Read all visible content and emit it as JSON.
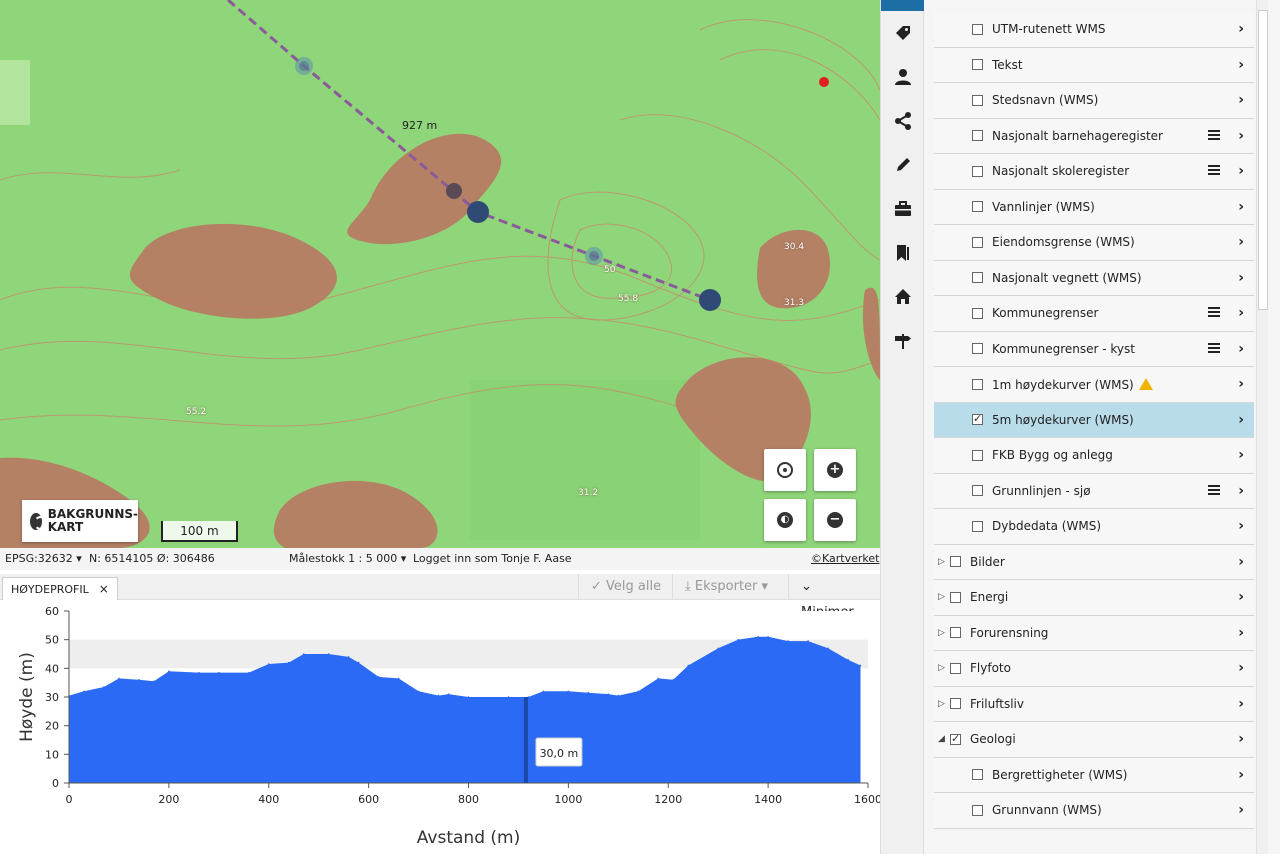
{
  "map": {
    "distance_label": "927 m",
    "contour_labels": [
      "30.4",
      "31.3",
      "55.8",
      "50",
      "55.2",
      "31.2"
    ],
    "basemap_button": {
      "line1": "BAKGRUNNS-",
      "line2": "KART"
    },
    "scale_label": "100 m"
  },
  "statusbar": {
    "projection": "EPSG:32632 ▾",
    "coordinates": "N: 6514105 Ø: 306486",
    "scale": "Målestokk 1 : 5 000 ▾",
    "user": "Logget inn som Tonje F. Aase",
    "attribution": "©Kartverket"
  },
  "profile": {
    "tab_label": "HØYDEPROFIL",
    "tab_close": "×",
    "select_all": "✓ Velg alle",
    "export": "⤓ Eksporter ▾",
    "minimize": "⌄ Minimer"
  },
  "chart_data": {
    "type": "area",
    "xlabel": "Avstand (m)",
    "ylabel": "Høyde (m)",
    "xlim": [
      0,
      1600
    ],
    "ylim": [
      0,
      60
    ],
    "xticks": [
      0,
      200,
      400,
      600,
      800,
      1000,
      1200,
      1400,
      1600
    ],
    "yticks": [
      0,
      10,
      20,
      30,
      40,
      50,
      60
    ],
    "x": [
      0,
      30,
      70,
      100,
      140,
      170,
      200,
      260,
      300,
      360,
      400,
      440,
      470,
      520,
      560,
      580,
      620,
      660,
      700,
      740,
      760,
      800,
      880,
      920,
      950,
      1000,
      1040,
      1080,
      1100,
      1140,
      1180,
      1210,
      1240,
      1300,
      1340,
      1380,
      1400,
      1440,
      1480,
      1520,
      1560,
      1585
    ],
    "values": [
      30.5,
      32,
      33.5,
      36.5,
      36,
      35.5,
      39,
      38.5,
      38.5,
      38.5,
      41.5,
      42,
      45,
      45,
      44,
      42,
      37,
      36.5,
      32,
      30.5,
      31,
      30,
      30,
      30,
      32,
      32,
      31.5,
      31,
      30.5,
      32,
      36.5,
      36,
      41,
      47,
      50,
      51,
      51,
      49.5,
      49.5,
      47,
      43,
      41
    ],
    "band": [
      40,
      50
    ],
    "cursor": {
      "x": 915,
      "label": "30,0 m"
    },
    "colors": {
      "fill": "#2b6af5",
      "band": "#eeeeee",
      "cursor": "#1a49a8"
    }
  },
  "layers": [
    {
      "label": "UTM-rutenett WMS",
      "checked": false,
      "menu": false,
      "level": 2
    },
    {
      "label": "Tekst",
      "checked": false,
      "menu": false,
      "level": 2
    },
    {
      "label": "Stedsnavn (WMS)",
      "checked": false,
      "menu": false,
      "level": 2
    },
    {
      "label": "Nasjonalt barnehageregister",
      "checked": false,
      "menu": true,
      "level": 2
    },
    {
      "label": "Nasjonalt skoleregister",
      "checked": false,
      "menu": true,
      "level": 2
    },
    {
      "label": "Vannlinjer (WMS)",
      "checked": false,
      "menu": false,
      "level": 2
    },
    {
      "label": "Eiendomsgrense (WMS)",
      "checked": false,
      "menu": false,
      "level": 2
    },
    {
      "label": "Nasjonalt vegnett (WMS)",
      "checked": false,
      "menu": false,
      "level": 2
    },
    {
      "label": "Kommunegrenser",
      "checked": false,
      "menu": true,
      "level": 2
    },
    {
      "label": "Kommunegrenser - kyst",
      "checked": false,
      "menu": true,
      "level": 2
    },
    {
      "label": "1m høydekurver (WMS)",
      "checked": false,
      "menu": false,
      "level": 2,
      "warning": true
    },
    {
      "label": "5m høydekurver (WMS)",
      "checked": true,
      "menu": false,
      "level": 2,
      "selected": true
    },
    {
      "label": "FKB Bygg og anlegg",
      "checked": false,
      "menu": false,
      "level": 2
    },
    {
      "label": "Grunnlinjen - sjø",
      "checked": false,
      "menu": true,
      "level": 2
    },
    {
      "label": "Dybdedata (WMS)",
      "checked": false,
      "menu": false,
      "level": 2
    },
    {
      "label": "Bilder",
      "checked": false,
      "menu": false,
      "level": 1,
      "expander": "▷"
    },
    {
      "label": "Energi",
      "checked": false,
      "menu": false,
      "level": 1,
      "expander": "▷"
    },
    {
      "label": "Forurensning",
      "checked": false,
      "menu": false,
      "level": 1,
      "expander": "▷"
    },
    {
      "label": "Flyfoto",
      "checked": false,
      "menu": false,
      "level": 1,
      "expander": "▷"
    },
    {
      "label": "Friluftsliv",
      "checked": false,
      "menu": false,
      "level": 1,
      "expander": "▷"
    },
    {
      "label": "Geologi",
      "checked": true,
      "menu": false,
      "level": 1,
      "expander": "◢"
    },
    {
      "label": "Bergrettigheter (WMS)",
      "checked": false,
      "menu": false,
      "level": 2
    },
    {
      "label": "Grunnvann (WMS)",
      "checked": false,
      "menu": false,
      "level": 2
    }
  ],
  "toolbar_icons": [
    "tag-icon",
    "person-icon",
    "share-icon",
    "pencil-icon",
    "briefcase-icon",
    "bookmark-icon",
    "home-icon",
    "signpost-icon"
  ]
}
